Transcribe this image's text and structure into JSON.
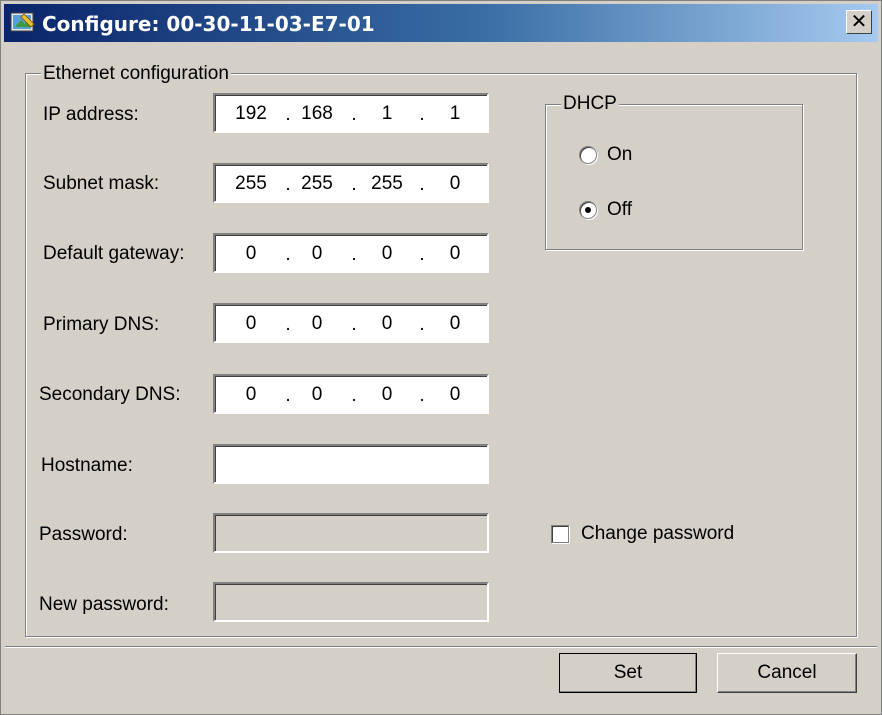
{
  "window": {
    "title": "Configure: 00-30-11-03-E7-01",
    "close_glyph": "✕"
  },
  "ethernet": {
    "group_label": "Ethernet configuration",
    "ip_address": {
      "label": "IP address:",
      "octets": [
        "192",
        "168",
        "1",
        "1"
      ]
    },
    "subnet_mask": {
      "label": "Subnet mask:",
      "octets": [
        "255",
        "255",
        "255",
        "0"
      ]
    },
    "default_gateway": {
      "label": "Default gateway:",
      "octets": [
        "0",
        "0",
        "0",
        "0"
      ]
    },
    "primary_dns": {
      "label": "Primary DNS:",
      "octets": [
        "0",
        "0",
        "0",
        "0"
      ]
    },
    "secondary_dns": {
      "label": "Secondary DNS:",
      "octets": [
        "0",
        "0",
        "0",
        "0"
      ]
    },
    "hostname": {
      "label": "Hostname:",
      "value": ""
    },
    "password": {
      "label": "Password:",
      "value": ""
    },
    "new_password": {
      "label": "New password:",
      "value": ""
    },
    "ip_separator": "."
  },
  "dhcp": {
    "group_label": "DHCP",
    "on_label": "On",
    "off_label": "Off",
    "selected": "Off"
  },
  "change_password": {
    "label": "Change password",
    "checked": false
  },
  "buttons": {
    "set": "Set",
    "cancel": "Cancel"
  },
  "icons": {
    "title_icon": "configure-app-icon",
    "close": "close-icon"
  }
}
